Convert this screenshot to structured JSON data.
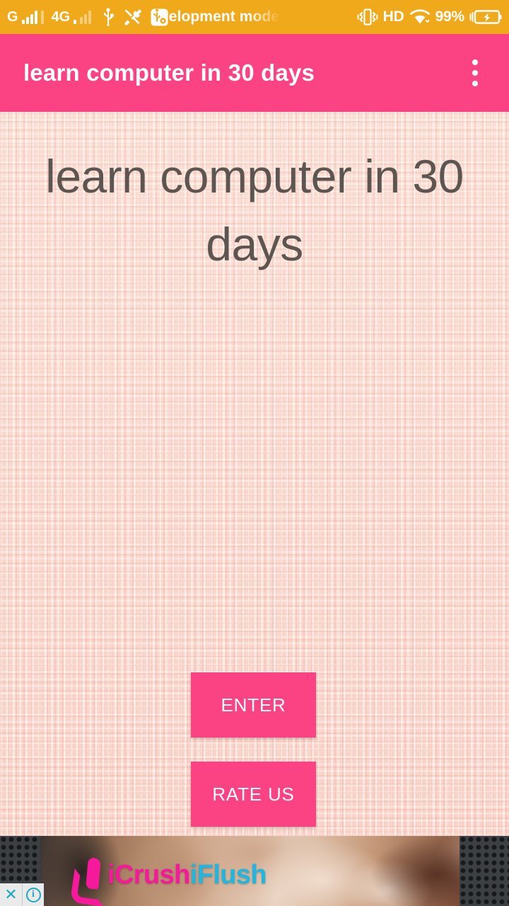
{
  "statusbar": {
    "network_type_1": "G",
    "network_type_2": "4G",
    "ticker_text": "development mode",
    "hd_label": "HD",
    "battery_percent": "99%",
    "icons": {
      "usb": "usb-icon",
      "tools": "developer-tools-icon",
      "usb_debug": "usb-debugging-icon",
      "vibrate": "vibrate-icon",
      "wifi": "wifi-icon",
      "battery": "battery-charging-icon"
    },
    "background_color": "#EFA91A",
    "foreground_color": "#FFFFFF"
  },
  "appbar": {
    "title": "learn computer in 30 days",
    "overflow_menu": "more-options",
    "background_color": "#FB4283",
    "title_color": "#FFFFFF"
  },
  "main": {
    "headline": "learn computer in 30 days",
    "headline_color": "#5C5550",
    "background_color": "#FADDD2",
    "buttons": [
      {
        "label": "ENTER",
        "name": "enter-button"
      },
      {
        "label": "RATE US",
        "name": "rate-us-button"
      }
    ],
    "button_color": "#FB4283",
    "button_text_color": "#FFFFFF"
  },
  "ad": {
    "brand_part_1": "iCrush",
    "brand_part_2": "iFlush",
    "brand_color_1": "#F6199B",
    "brand_color_2": "#21B6E0",
    "close_label": "✕",
    "info_label": "i"
  }
}
